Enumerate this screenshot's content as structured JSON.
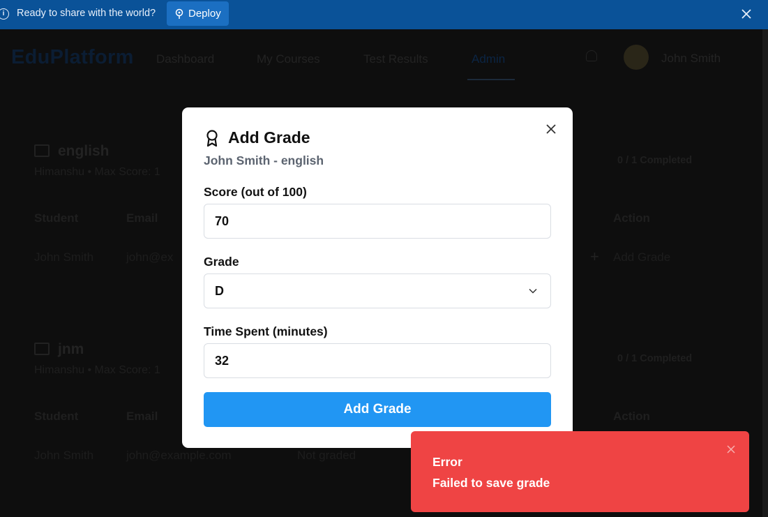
{
  "banner": {
    "message": "Ready to share with the world?",
    "deploy_label": "Deploy",
    "info_icon": "info-icon",
    "color": "#0a5298"
  },
  "app": {
    "logo": "EduPlatform",
    "nav": [
      "Dashboard",
      "My Courses",
      "Test Results",
      "Admin"
    ],
    "active_nav": "Admin",
    "user": "John Smith",
    "sections": [
      {
        "title": "english",
        "subtitle": "Himanshu • Max Score: 1",
        "completed": "0 / 1 Completed",
        "headers": [
          "Student",
          "Email",
          "Action"
        ],
        "row": {
          "student": "John Smith",
          "email": "john@ex",
          "action": "Add Grade"
        }
      },
      {
        "title": "jnm",
        "subtitle": "Himanshu • Max Score: 1",
        "completed": "0 / 1 Completed",
        "headers": [
          "Student",
          "Email",
          "Action"
        ],
        "row": {
          "student": "John Smith",
          "email": "john@example.com",
          "status": "Not graded"
        }
      }
    ]
  },
  "modal": {
    "title": "Add Grade",
    "subtitle": "John Smith - english",
    "score_label": "Score (out of 100)",
    "score_value": "70",
    "grade_label": "Grade",
    "grade_value": "D",
    "time_label": "Time Spent (minutes)",
    "time_value": "32",
    "submit_label": "Add Grade",
    "accent": "#2196f3"
  },
  "toast": {
    "title": "Error",
    "message": "Failed to save grade",
    "color": "#ef4444"
  }
}
